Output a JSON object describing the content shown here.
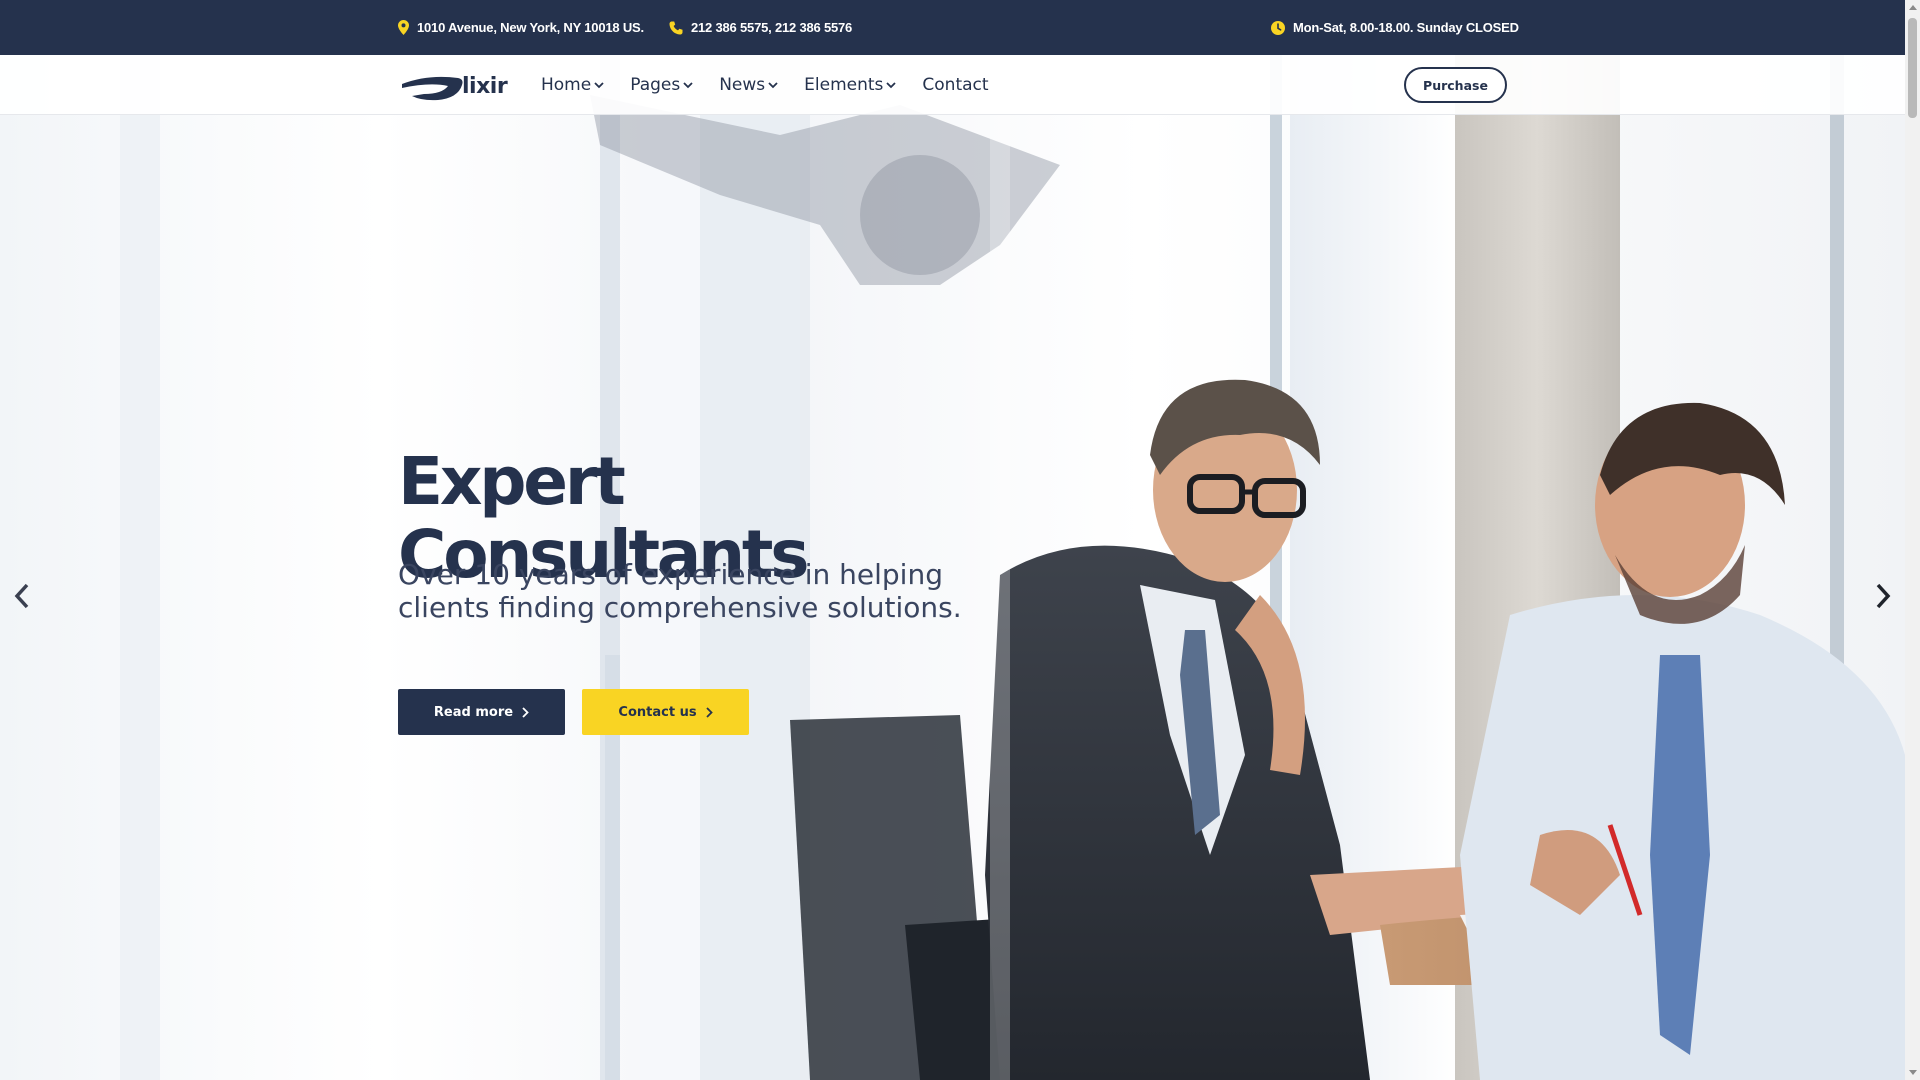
{
  "topbar": {
    "address": "1010 Avenue, New York, NY 10018 US.",
    "phone": "212 386 5575, 212 386 5576",
    "hours": "Mon-Sat, 8.00-18.00. Sunday CLOSED"
  },
  "nav": {
    "logo_text": "lixir",
    "menu": [
      {
        "label": "Home",
        "dropdown": true
      },
      {
        "label": "Pages",
        "dropdown": true
      },
      {
        "label": "News",
        "dropdown": true
      },
      {
        "label": "Elements",
        "dropdown": true
      },
      {
        "label": "Contact",
        "dropdown": false
      }
    ],
    "purchase_label": "Purchase"
  },
  "hero": {
    "headline": "Expert Consultants",
    "subtitle": "Over 10 years of experience in helping clients finding comprehensive solutions.",
    "primary_button": "Read more",
    "secondary_button": "Contact us"
  },
  "icons": {
    "address": "map-pin-icon",
    "phone": "phone-icon",
    "hours": "clock-icon",
    "prev": "chevron-left-icon",
    "next": "chevron-right-icon"
  },
  "colors": {
    "navy": "#25324d",
    "accent_yellow": "#f9d423",
    "white": "#ffffff"
  }
}
